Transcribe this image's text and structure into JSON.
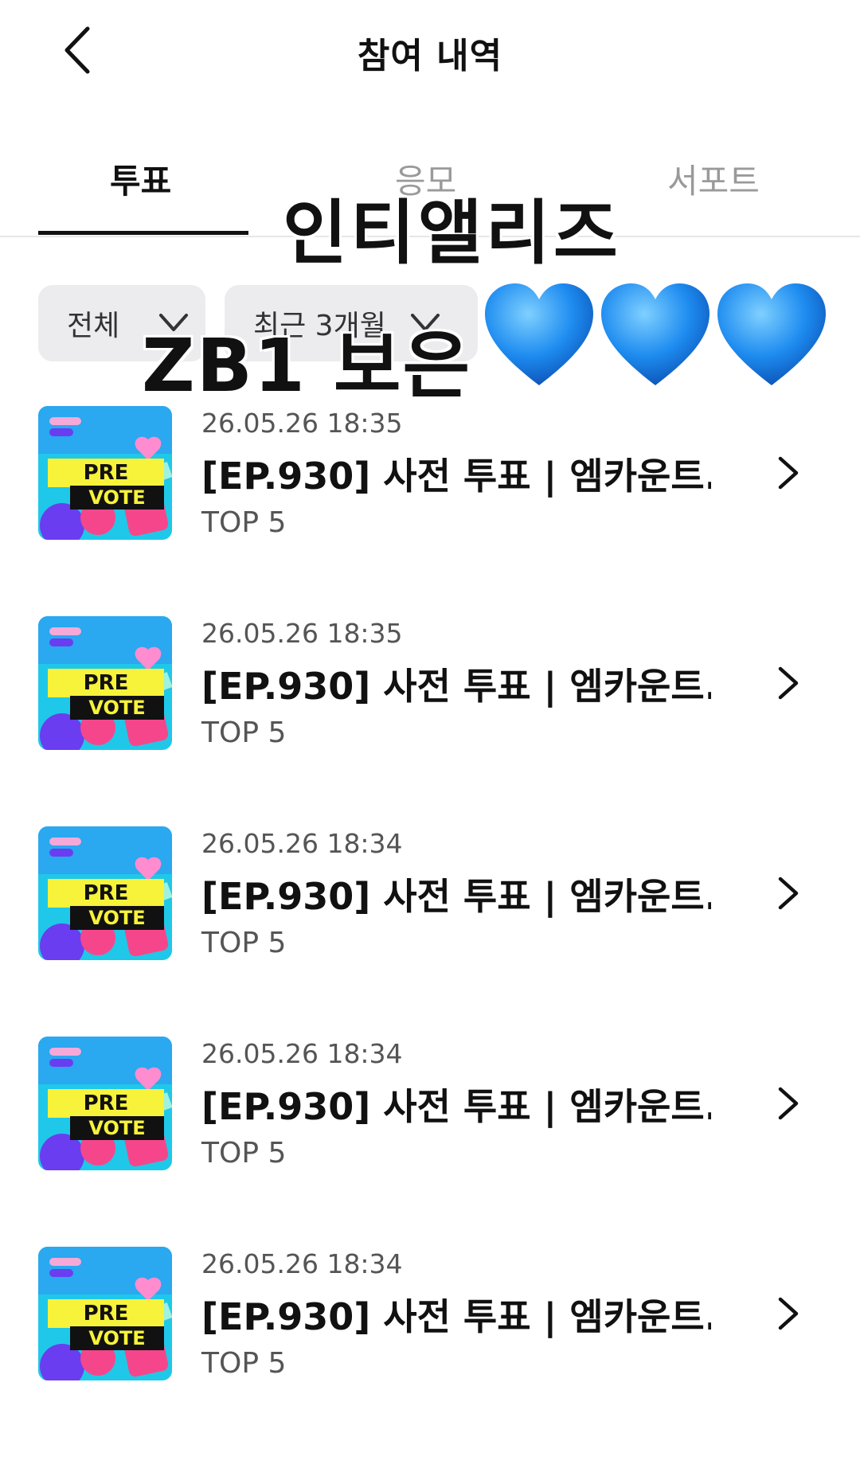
{
  "header": {
    "title": "참여 내역"
  },
  "tabs": [
    {
      "label": "투표",
      "active": true
    },
    {
      "label": "응모",
      "active": false
    },
    {
      "label": "서포트",
      "active": false
    }
  ],
  "filters": [
    {
      "label": "전체"
    },
    {
      "label": "최근 3개월"
    }
  ],
  "thumbnail": {
    "line1": "PRE",
    "line2": "VOTE"
  },
  "items": [
    {
      "date": "26.05.26 18:35",
      "title": "[EP.930] 사전 투표 | 엠카운트...",
      "subtitle": "TOP 5"
    },
    {
      "date": "26.05.26 18:35",
      "title": "[EP.930] 사전 투표 | 엠카운트...",
      "subtitle": "TOP 5"
    },
    {
      "date": "26.05.26 18:34",
      "title": "[EP.930] 사전 투표 | 엠카운트...",
      "subtitle": "TOP 5"
    },
    {
      "date": "26.05.26 18:34",
      "title": "[EP.930] 사전 투표 | 엠카운트...",
      "subtitle": "TOP 5"
    },
    {
      "date": "26.05.26 18:34",
      "title": "[EP.930] 사전 투표 | 엠카운트...",
      "subtitle": "TOP 5"
    }
  ],
  "overlay": {
    "line1": "인티앨리즈",
    "line2": "ZB1 보은",
    "hearts": [
      "💙",
      "💙",
      "💙"
    ],
    "heart_color": "#1e8cf0"
  },
  "colors": {
    "accent": "#111111",
    "thumb_bg": "#1fc8e8",
    "thumb_yellow": "#f7f23a",
    "thumb_pink": "#f5468c"
  }
}
